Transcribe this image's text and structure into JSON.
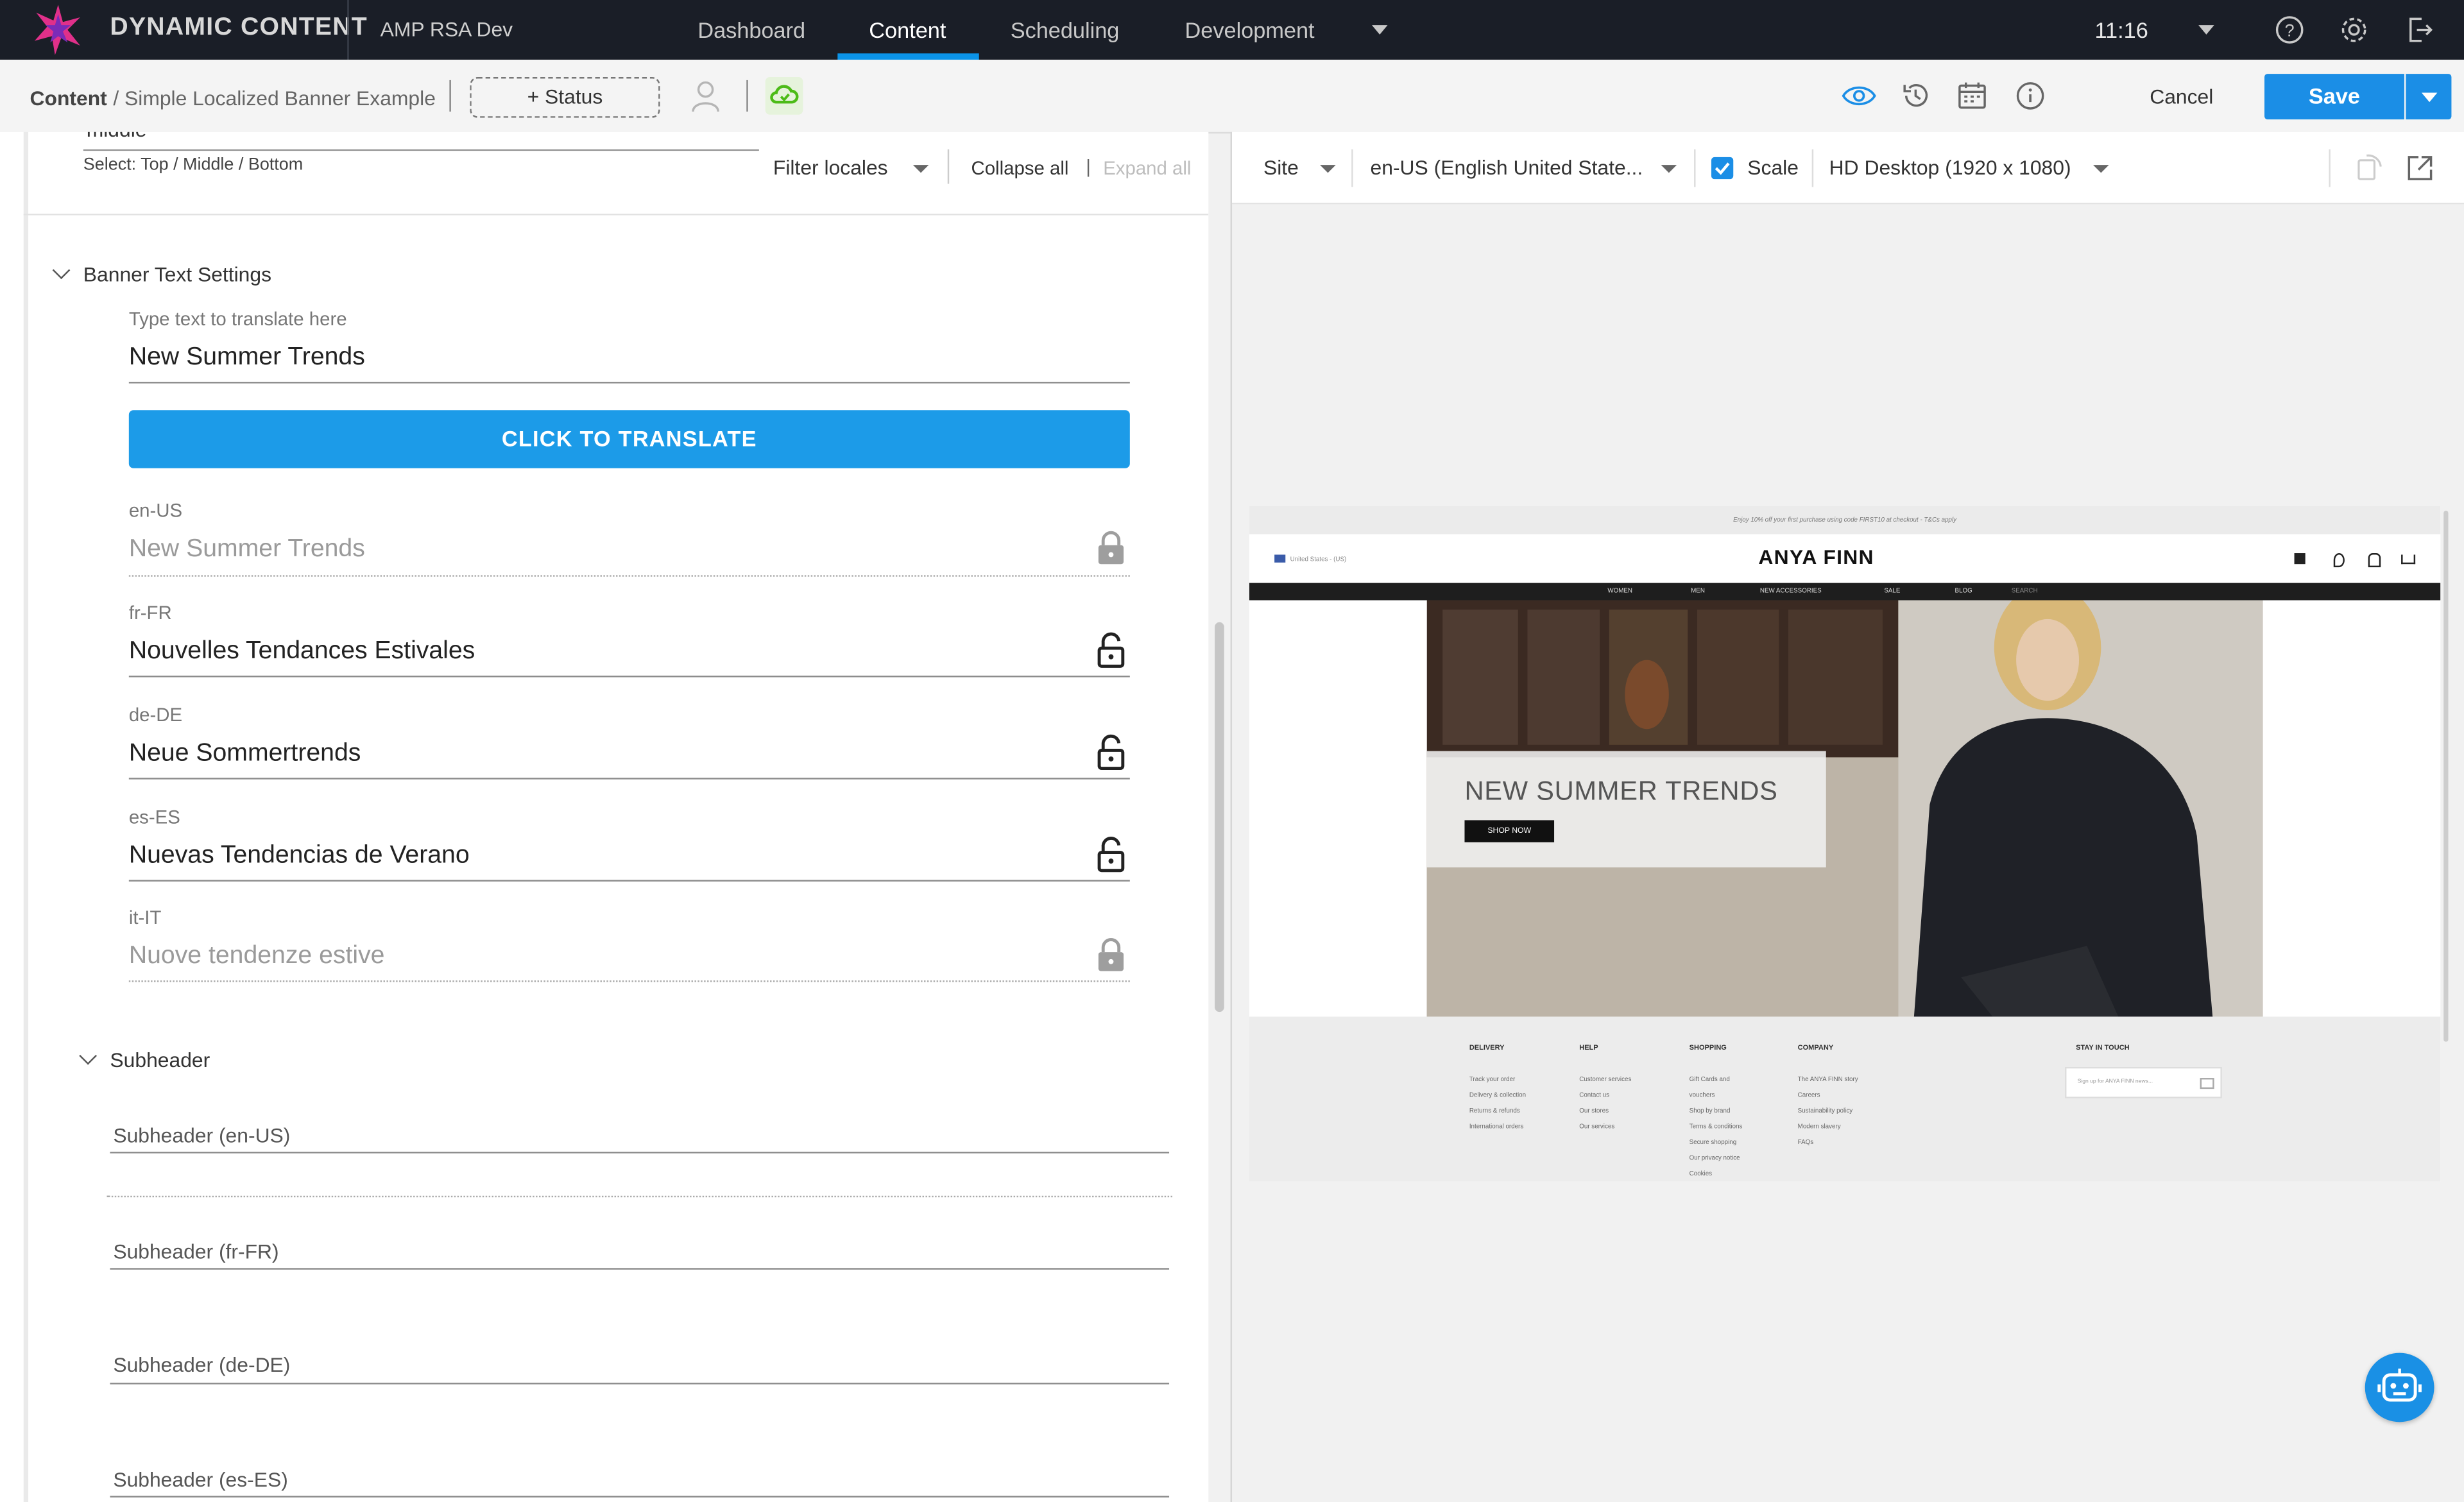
{
  "app": {
    "brand": "DYNAMIC CONTENT",
    "hub": "AMP RSA Dev",
    "nav": [
      "Dashboard",
      "Content",
      "Scheduling",
      "Development"
    ],
    "active_tab": "Content",
    "time": "11:16"
  },
  "toolbar": {
    "breadcrumb_root": "Content",
    "breadcrumb_item": "/ Simple Localized Banner Example",
    "status_label": "+ Status",
    "cancel_label": "Cancel",
    "save_label": "Save"
  },
  "editor": {
    "top_field_value": "middle",
    "top_field_hint": "Select: Top / Middle / Bottom",
    "filter_locales": "Filter locales",
    "collapse_all": "Collapse all",
    "expand_sep": "|",
    "expand_all": "Expand all",
    "banner_section": {
      "title": "Banner Text Settings",
      "source_label": "Type text to translate here",
      "source_value": "New Summer Trends",
      "translate_button": "CLICK TO TRANSLATE",
      "locales": [
        {
          "code": "en-US",
          "value": "New Summer Trends",
          "locked": true
        },
        {
          "code": "fr-FR",
          "value": "Nouvelles Tendances Estivales",
          "locked": false
        },
        {
          "code": "de-DE",
          "value": "Neue Sommertrends",
          "locked": false
        },
        {
          "code": "es-ES",
          "value": "Nuevas Tendencias de Verano",
          "locked": false
        },
        {
          "code": "it-IT",
          "value": "Nuove tendenze estive",
          "locked": true
        }
      ]
    },
    "subheader_section": {
      "title": "Subheader",
      "fields": [
        "Subheader (en-US)",
        "Subheader (fr-FR)",
        "Subheader (de-DE)",
        "Subheader (es-ES)"
      ]
    }
  },
  "preview": {
    "site_select": "Site",
    "locale_select": "en-US (English United State...",
    "scale_label": "Scale",
    "scale_checked": true,
    "device_select": "HD Desktop (1920 x 1080)",
    "site": {
      "promo": "Enjoy 10% off your first purchase using code FIRST10 at checkout - T&Cs apply",
      "region": "United States - (US)",
      "logo": "ANYA FINN",
      "nav": [
        "WOMEN",
        "MEN",
        "NEW ACCESSORIES",
        "SALE",
        "BLOG",
        "SEARCH"
      ],
      "hero_title": "NEW SUMMER TRENDS",
      "shop_now": "SHOP NOW",
      "footer": {
        "delivery": {
          "heading": "DELIVERY",
          "items": [
            "Track your order",
            "Delivery & collection",
            "Returns & refunds",
            "International orders"
          ]
        },
        "help": {
          "heading": "HELP",
          "items": [
            "Customer services",
            "Contact us",
            "Our stores",
            "Our services"
          ]
        },
        "shopping": {
          "heading": "SHOPPING",
          "items": [
            "Gift Cards and",
            "vouchers",
            "Shop by brand",
            "Terms & conditions",
            "Secure shopping",
            "Our privacy notice",
            "Cookies"
          ]
        },
        "company": {
          "heading": "COMPANY",
          "items": [
            "The ANYA FINN story",
            "Careers",
            "Sustainability policy",
            "Modern slavery",
            "FAQs"
          ]
        },
        "stay": {
          "heading": "STAY IN TOUCH",
          "placeholder": "Sign up for ANYA FINN news..."
        }
      }
    }
  },
  "colors": {
    "accent": "#1b8ee6",
    "topbar": "#1a1e27",
    "sync": "#4cbb17"
  }
}
